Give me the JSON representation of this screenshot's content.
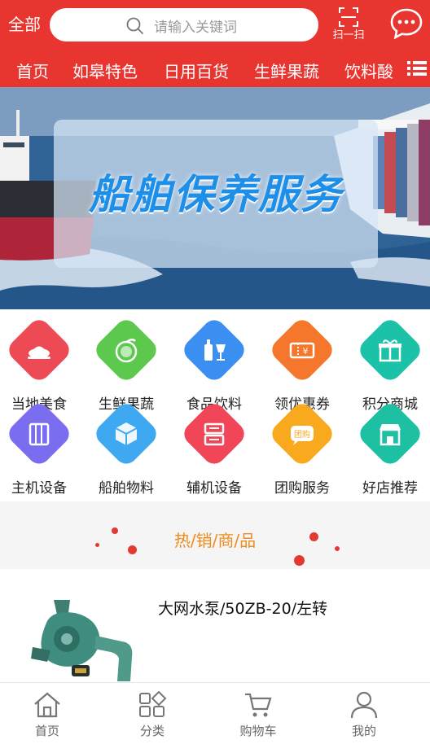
{
  "header": {
    "all_label": "全部",
    "search_placeholder": "请输入关键词",
    "scan_label": "扫一扫"
  },
  "nav": {
    "tabs": [
      "首页",
      "如皋特色",
      "日用百货",
      "生鲜果蔬",
      "饮料酸"
    ]
  },
  "banner": {
    "title": "船舶保养服务"
  },
  "categories": [
    {
      "label": "当地美食",
      "icon": "food-icon",
      "color": "#ee4a55"
    },
    {
      "label": "生鲜果蔬",
      "icon": "fruit-icon",
      "color": "#5cc94e"
    },
    {
      "label": "食品饮料",
      "icon": "drink-icon",
      "color": "#3a8ff0"
    },
    {
      "label": "领优惠券",
      "icon": "coupon-icon",
      "color": "#f5772c"
    },
    {
      "label": "积分商城",
      "icon": "gift-icon",
      "color": "#1bc2a8"
    },
    {
      "label": "主机设备",
      "icon": "cabinet-icon",
      "color": "#7a6df0"
    },
    {
      "label": "船舶物料",
      "icon": "box-icon",
      "color": "#3ea9f0"
    },
    {
      "label": "辅机设备",
      "icon": "device-icon",
      "color": "#f04658"
    },
    {
      "label": "团购服务",
      "icon": "group-buy-icon",
      "color": "#f8a91e"
    },
    {
      "label": "好店推荐",
      "icon": "store-icon",
      "color": "#1ec0a4"
    }
  ],
  "hot": {
    "title": "热/销/商/品"
  },
  "product": {
    "name": "大网水泵/50ZB-20/左转"
  },
  "tabbar": [
    "首页",
    "分类",
    "购物车",
    "我的"
  ],
  "colors": {
    "brand": "#e8352f",
    "accent": "#f08a1c"
  }
}
